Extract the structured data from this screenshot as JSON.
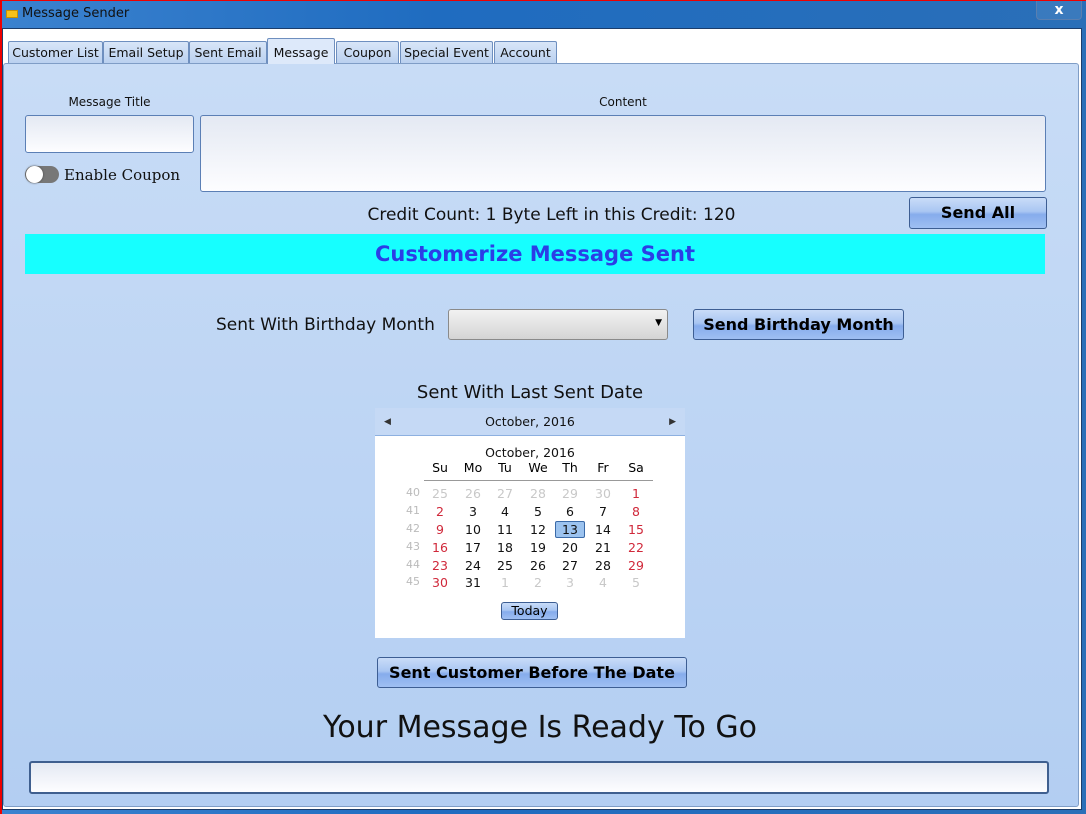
{
  "window": {
    "title": "Message Sender",
    "close_icon": "x"
  },
  "tabs": [
    {
      "label": "Customer List"
    },
    {
      "label": "Email Setup"
    },
    {
      "label": "Sent Email"
    },
    {
      "label": "Message",
      "active": true
    },
    {
      "label": "Coupon"
    },
    {
      "label": "Special Event"
    },
    {
      "label": "Account"
    }
  ],
  "message": {
    "title_label": "Message Title",
    "title_value": "",
    "content_label": "Content",
    "content_value": "",
    "coupon_toggle_label": "Enable Coupon",
    "coupon_enabled": false,
    "credit_text": "Credit Count: 1  Byte Left in this Credit: 120",
    "send_all": "Send All",
    "banner": "Customerize Message Sent",
    "birthday_label": "Sent With Birthday Month",
    "birthday_value": "",
    "send_birthday": "Send Birthday Month",
    "last_date_label": "Sent With Last Sent Date",
    "send_before": "Sent Customer Before The Date",
    "status": "Your Message Is Ready To Go",
    "output_value": ""
  },
  "calendar": {
    "header": "October, 2016",
    "month_title": "October, 2016",
    "days": [
      "Su",
      "Mo",
      "Tu",
      "We",
      "Th",
      "Fr",
      "Sa"
    ],
    "weeks": [
      {
        "n": "40",
        "d": [
          "25",
          "26",
          "27",
          "28",
          "29",
          "30",
          "1"
        ]
      },
      {
        "n": "41",
        "d": [
          "2",
          "3",
          "4",
          "5",
          "6",
          "7",
          "8"
        ]
      },
      {
        "n": "42",
        "d": [
          "9",
          "10",
          "11",
          "12",
          "13",
          "14",
          "15"
        ]
      },
      {
        "n": "43",
        "d": [
          "16",
          "17",
          "18",
          "19",
          "20",
          "21",
          "22"
        ]
      },
      {
        "n": "44",
        "d": [
          "23",
          "24",
          "25",
          "26",
          "27",
          "28",
          "29"
        ]
      },
      {
        "n": "45",
        "d": [
          "30",
          "31",
          "1",
          "2",
          "3",
          "4",
          "5"
        ]
      }
    ],
    "selected": "13",
    "today": "Today",
    "colors": {
      "weekend": "#d0283a",
      "other_month": "#c8c8c8",
      "selected_bg": "#9cc3ef"
    }
  }
}
